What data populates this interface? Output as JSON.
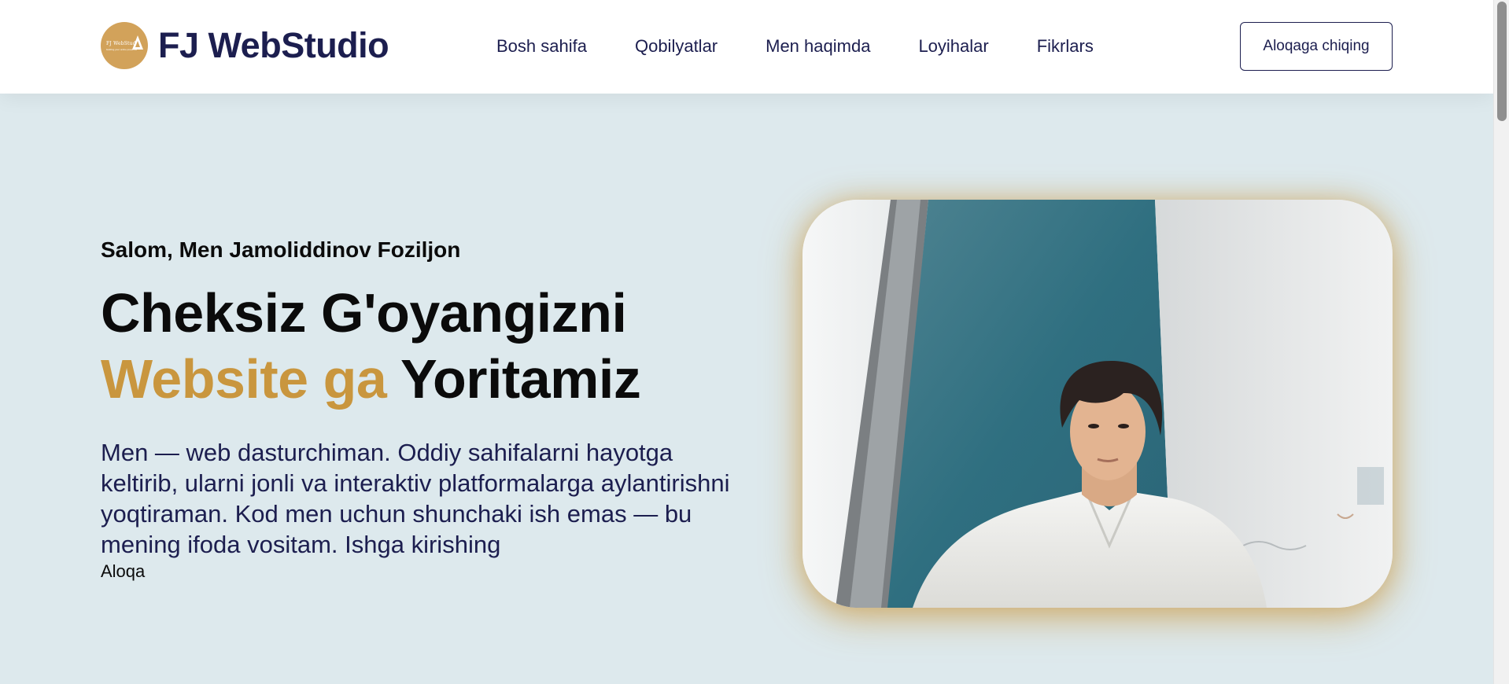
{
  "header": {
    "brand": "FJ WebStudio",
    "logo_mark_text": "FJ WebStudio",
    "logo_mark_sub": "building your online presence",
    "nav": [
      {
        "label": "Bosh sahifa"
      },
      {
        "label": "Qobilyatlar"
      },
      {
        "label": "Men haqimda"
      },
      {
        "label": "Loyihalar"
      },
      {
        "label": "Fikrlars"
      }
    ],
    "contact_button": "Aloqaga chiqing"
  },
  "hero": {
    "greeting": "Salom, Men Jamoliddinov Foziljon",
    "headline_line1": "Cheksiz G'oyangizni",
    "headline_accent": "Website ga",
    "headline_rest": " Yoritamiz",
    "intro": "Men — web dasturchiman. Oddiy sahifalarni hayotga keltirib, ularni jonli va interaktiv platformalarga aylantirishni yoqtiraman. Kod men uchun shunchaki ish emas — bu mening ifoda vositam. Ishga kirishing",
    "contact_link": "Aloqa"
  },
  "colors": {
    "brand_navy": "#1c1e4f",
    "accent_gold": "#c9963e",
    "hero_bg": "#dde9ed",
    "header_bg": "#ffffff"
  },
  "icons": {
    "logo": "brand-logo-icon",
    "photo": "profile-photo"
  }
}
